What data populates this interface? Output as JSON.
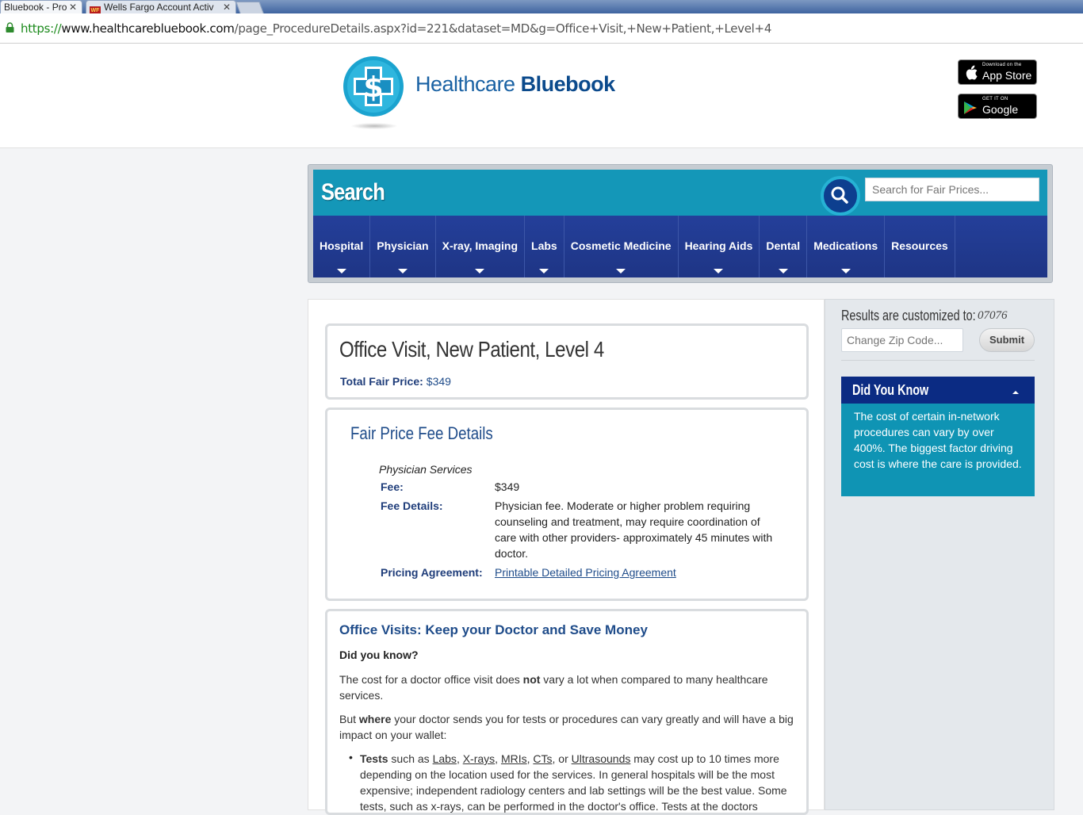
{
  "browser": {
    "tabs": [
      {
        "label": "Bluebook - Pro",
        "active": true
      },
      {
        "label": "Wells Fargo Account Activ",
        "active": false,
        "favicon": "WF"
      }
    ],
    "url": {
      "protocol": "https://",
      "host": "www.healthcarebluebook.com",
      "path": "/page_ProcedureDetails.aspx?id=221&dataset=MD&g=Office+Visit,+New+Patient,+Level+4"
    }
  },
  "header": {
    "logo_light": "Healthcare",
    "logo_bold": "Bluebook",
    "app_store": {
      "small": "Download on the",
      "big": "App Store"
    },
    "google_play": {
      "small": "GET IT ON",
      "big": "Google play"
    }
  },
  "search": {
    "title": "Search",
    "placeholder": "Search for Fair Prices...",
    "nav": [
      "Hospital",
      "Physician",
      "X-ray, Imaging",
      "Labs",
      "Cosmetic Medicine",
      "Hearing Aids",
      "Dental",
      "Medications",
      "Resources"
    ]
  },
  "procedure": {
    "title": "Office Visit, New Patient, Level 4",
    "total_label": "Total Fair Price:",
    "total_value": "$349"
  },
  "fee_details": {
    "title": "Fair Price Fee Details",
    "service_header": "Physician Services",
    "fee_label": "Fee:",
    "fee_value": "$349",
    "details_label": "Fee Details:",
    "details_value": "Physician fee. Moderate or higher problem requiring counseling and treatment, may require coordination of care with other providers- approximately 45 minutes with doctor.",
    "agreement_label": "Pricing Agreement:",
    "agreement_link": "Printable Detailed Pricing Agreement"
  },
  "tips": {
    "title": "Office Visits: Keep your Doctor and Save Money",
    "question": "Did you know?",
    "p1_a": "The cost for a doctor office visit does ",
    "p1_b": "not",
    "p1_c": " vary a lot when compared to many healthcare services.",
    "p2_a": "But ",
    "p2_b": "where",
    "p2_c": " your doctor sends you for tests or procedures can vary greatly and will have a big impact on your wallet:",
    "b1_bold": "Tests",
    "b1_pre": " such as ",
    "b1_links": [
      "Labs",
      "X-rays",
      "MRIs",
      "CTs",
      "Ultrasounds"
    ],
    "b1_or": ", or ",
    "b1_rest": " may cost up to 10 times more depending on the location used for the services. In general hospitals will be the most expensive; independent radiology centers and lab settings will be the best value. Some tests, such as x-rays, can be performed in the doctor's office. Tests at the doctors"
  },
  "sidebar": {
    "customized_label": "Results are customized to:",
    "zip": "07076",
    "zip_placeholder": "Change Zip Code...",
    "submit": "Submit",
    "dyk_title": "Did You Know",
    "dyk_body": "The cost of certain in-network procedures can vary by over 400%. The biggest factor driving cost is where the care is provided."
  },
  "colors": {
    "brand_blue": "#1a62a4",
    "search_teal": "#1497b8",
    "nav_navy": "#1e3585",
    "dyk_navy": "#0b2b83",
    "dyk_teal": "#0f94b4"
  }
}
